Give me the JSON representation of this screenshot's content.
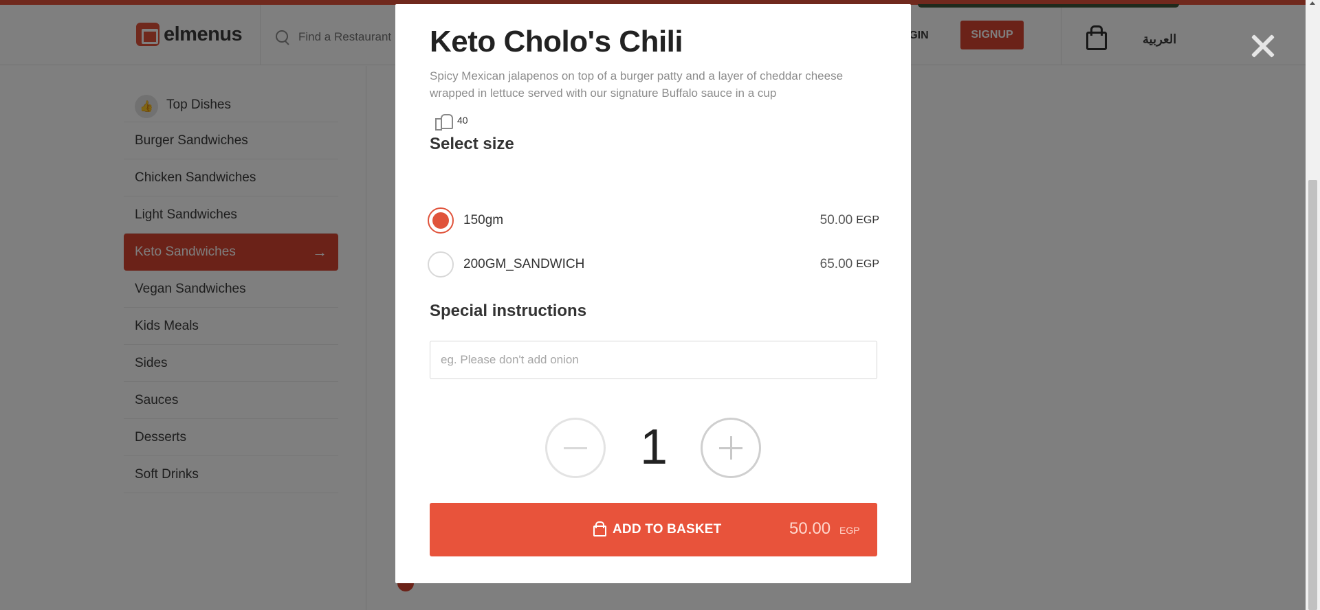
{
  "header": {
    "logo_text": "elmenus",
    "search_placeholder": "Find a Restaurant",
    "login_label": "LOGIN",
    "signup_label": "SIGNUP",
    "language_label": "العربية"
  },
  "sidebar": {
    "items": [
      {
        "label": "Top Dishes"
      },
      {
        "label": "Burger Sandwiches"
      },
      {
        "label": "Chicken Sandwiches"
      },
      {
        "label": "Light Sandwiches"
      },
      {
        "label": "Keto Sandwiches"
      },
      {
        "label": "Vegan Sandwiches"
      },
      {
        "label": "Kids Meals"
      },
      {
        "label": "Sides"
      },
      {
        "label": "Sauces"
      },
      {
        "label": "Desserts"
      },
      {
        "label": "Soft Drinks"
      }
    ],
    "active_index": 4
  },
  "modal": {
    "title": "Keto Cholo's Chili",
    "description": "Spicy Mexican jalapenos on top of a burger patty and a layer of cheddar cheese wrapped in lettuce served with our signature Buffalo sauce in a cup",
    "likes": "40",
    "size_section_title": "Select size",
    "sizes": [
      {
        "label": "150gm",
        "price": "50.00",
        "currency": "EGP",
        "selected": true
      },
      {
        "label": "200GM_SANDWICH",
        "price": "65.00",
        "currency": "EGP",
        "selected": false
      }
    ],
    "instructions_title": "Special instructions",
    "instructions_placeholder": "eg. Please don't add onion",
    "quantity": "1",
    "add_button_label": "ADD TO BASKET",
    "total_price": "50.00",
    "total_currency": "EGP"
  },
  "colors": {
    "brand": "#e0533b",
    "active_menu": "#d64530",
    "overlay": "rgba(0,0,0,0.5)"
  },
  "icons": [
    "search-icon",
    "bag-icon",
    "thumbs-up-icon",
    "arrow-right-icon",
    "close-icon",
    "minus-icon",
    "plus-icon",
    "lock-icon"
  ]
}
